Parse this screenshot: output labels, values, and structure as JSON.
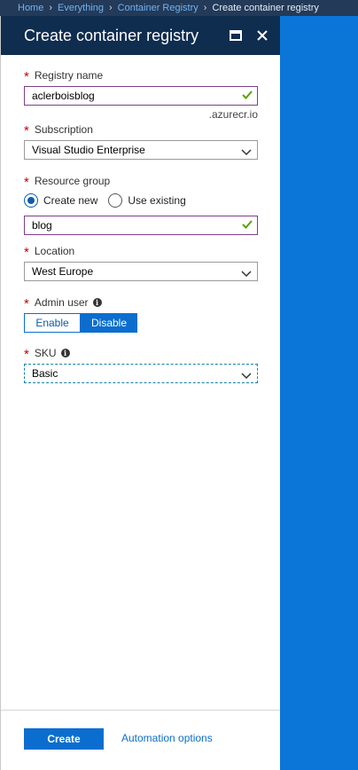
{
  "breadcrumb": {
    "items": [
      "Home",
      "Everything",
      "Container Registry"
    ],
    "current": "Create container registry"
  },
  "blade": {
    "title": "Create container registry"
  },
  "form": {
    "registry_name": {
      "label": "Registry name",
      "value": "aclerboisblog",
      "suffix": ".azurecr.io"
    },
    "subscription": {
      "label": "Subscription",
      "value": "Visual Studio Enterprise"
    },
    "resource_group": {
      "label": "Resource group",
      "options": [
        "Create new",
        "Use existing"
      ],
      "selected": "Create new",
      "value": "blog"
    },
    "location": {
      "label": "Location",
      "value": "West Europe"
    },
    "admin_user": {
      "label": "Admin user",
      "options": [
        "Enable",
        "Disable"
      ],
      "selected": "Disable"
    },
    "sku": {
      "label": "SKU",
      "value": "Basic"
    }
  },
  "footer": {
    "create_label": "Create",
    "automation_label": "Automation options"
  },
  "colors": {
    "accent": "#0b6ecf",
    "header_bg": "#0e2d4f",
    "valid": "#57a300",
    "required": "#c00000"
  },
  "icons": {
    "maximize": "maximize-icon",
    "close": "close-icon",
    "check": "checkmark-icon",
    "chevron": "chevron-down-icon",
    "info": "info-icon"
  }
}
